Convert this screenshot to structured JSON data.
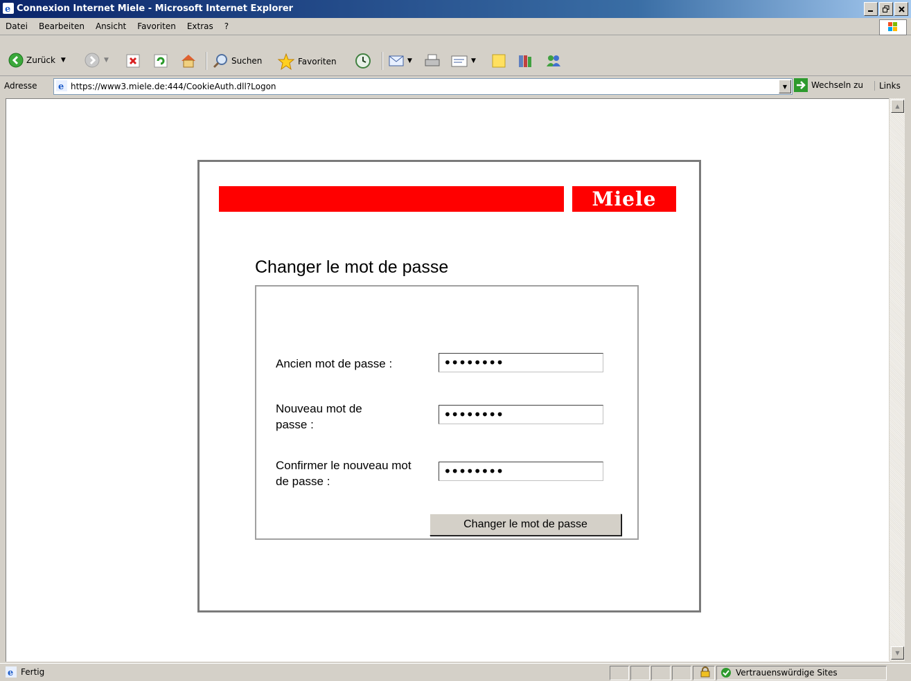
{
  "window": {
    "title": "Connexion Internet Miele - Microsoft Internet Explorer",
    "buttons": {
      "minimize": "_",
      "maximize": "´",
      "close": "×"
    }
  },
  "menu": [
    "Datei",
    "Bearbeiten",
    "Ansicht",
    "Favoriten",
    "Extras",
    "?"
  ],
  "toolbar": {
    "back_label": "Zurück",
    "search_label": "Suchen",
    "favorites_label": "Favoriten"
  },
  "address": {
    "label": "Adresse",
    "url": "https://www3.miele.de:444/CookieAuth.dll?Logon",
    "go_label": "Wechseln zu",
    "links_label": "Links"
  },
  "page": {
    "logo_text": "Miele",
    "heading": "Changer le mot de passe",
    "fields": [
      {
        "label": "Ancien mot de passe :",
        "value": "••••••••"
      },
      {
        "label": "Nouveau mot de passe :",
        "value": "••••••••"
      },
      {
        "label": "Confirmer le nouveau mot de passe :",
        "value": "••••••••"
      }
    ],
    "submit_label": "Changer le mot de passe",
    "brand_color": "#ff0000"
  },
  "status": {
    "text": "Fertig",
    "zone": "Vertrauenswürdige Sites"
  }
}
